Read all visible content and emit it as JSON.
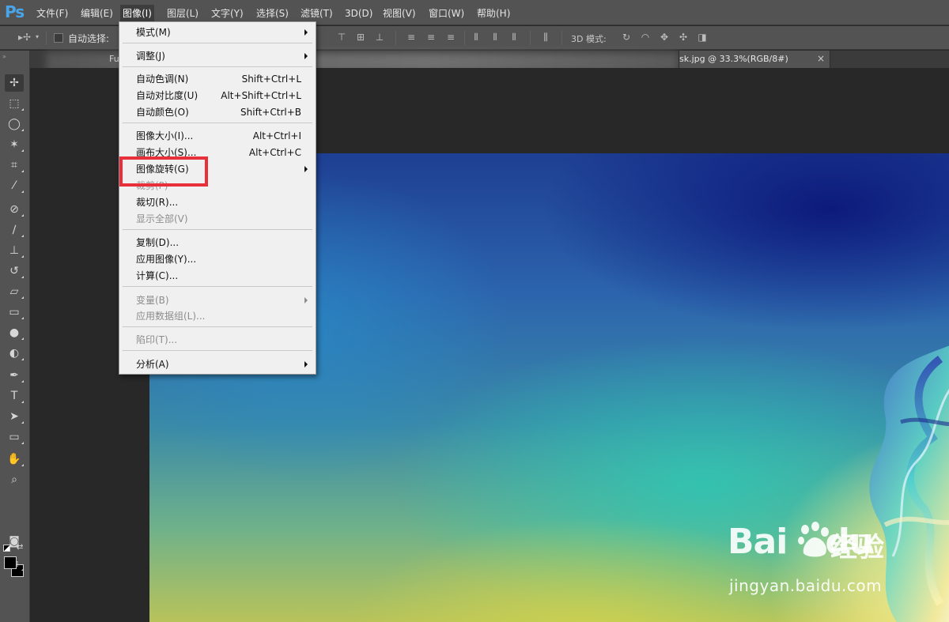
{
  "app": {
    "logo": "Ps"
  },
  "menubar": {
    "items": [
      {
        "label": "文件(F)"
      },
      {
        "label": "编辑(E)"
      },
      {
        "label": "图像(I)"
      },
      {
        "label": "图层(L)"
      },
      {
        "label": "文字(Y)"
      },
      {
        "label": "选择(S)"
      },
      {
        "label": "滤镜(T)"
      },
      {
        "label": "3D(D)"
      },
      {
        "label": "视图(V)"
      },
      {
        "label": "窗口(W)"
      },
      {
        "label": "帮助(H)"
      }
    ],
    "active": "图像(I)"
  },
  "options": {
    "auto_select_label": "自动选择:",
    "auto_select_checked": false,
    "mode3d_label": "3D 模式:"
  },
  "tabs": {
    "partial_label": "Fu",
    "active_label": "sk.jpg @ 33.3%(RGB/8#)",
    "close_icon": "×"
  },
  "image_menu": {
    "items": [
      {
        "label": "模式(M)",
        "shortcut": "",
        "submenu": true,
        "disabled": false
      },
      {
        "label": "调整(J)",
        "shortcut": "",
        "submenu": true,
        "disabled": false
      },
      {
        "label": "自动色调(N)",
        "shortcut": "Shift+Ctrl+L",
        "submenu": false,
        "disabled": false
      },
      {
        "label": "自动对比度(U)",
        "shortcut": "Alt+Shift+Ctrl+L",
        "submenu": false,
        "disabled": false
      },
      {
        "label": "自动颜色(O)",
        "shortcut": "Shift+Ctrl+B",
        "submenu": false,
        "disabled": false
      },
      {
        "label": "图像大小(I)...",
        "shortcut": "Alt+Ctrl+I",
        "submenu": false,
        "disabled": false
      },
      {
        "label": "画布大小(S)...",
        "shortcut": "Alt+Ctrl+C",
        "submenu": false,
        "disabled": false
      },
      {
        "label": "图像旋转(G)",
        "shortcut": "",
        "submenu": true,
        "disabled": false,
        "highlighted": true
      },
      {
        "label": "裁剪(P)",
        "shortcut": "",
        "submenu": false,
        "disabled": true,
        "partially_hidden": true
      },
      {
        "label": "裁切(R)...",
        "shortcut": "",
        "submenu": false,
        "disabled": false
      },
      {
        "label": "显示全部(V)",
        "shortcut": "",
        "submenu": false,
        "disabled": true
      },
      {
        "label": "复制(D)...",
        "shortcut": "",
        "submenu": false,
        "disabled": false
      },
      {
        "label": "应用图像(Y)...",
        "shortcut": "",
        "submenu": false,
        "disabled": false
      },
      {
        "label": "计算(C)...",
        "shortcut": "",
        "submenu": false,
        "disabled": false
      },
      {
        "label": "变量(B)",
        "shortcut": "",
        "submenu": true,
        "disabled": true
      },
      {
        "label": "应用数据组(L)...",
        "shortcut": "",
        "submenu": false,
        "disabled": true
      },
      {
        "label": "陷印(T)...",
        "shortcut": "",
        "submenu": false,
        "disabled": true
      },
      {
        "label": "分析(A)",
        "shortcut": "",
        "submenu": true,
        "disabled": false
      }
    ]
  },
  "colors": {
    "menubar_bg": "#535353",
    "workspace_bg": "#282828",
    "menu_bg": "#f0f0f0",
    "highlight_border": "#e8303a",
    "foreground_color": "#000000",
    "background_color": "#000000"
  },
  "watermark": {
    "brand_left": "Bai",
    "brand_right": "du",
    "product": "经验",
    "url": "jingyan.baidu.com"
  }
}
